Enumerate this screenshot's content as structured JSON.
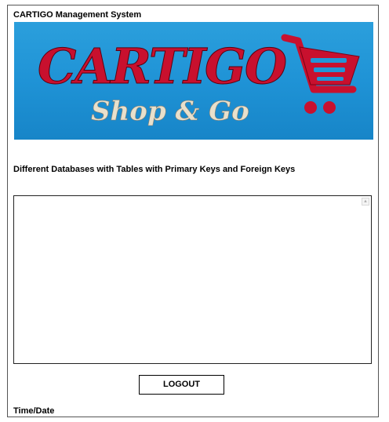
{
  "window": {
    "title": "CARTIGO Management System"
  },
  "banner": {
    "brand": "CARTIGO",
    "tagline": "Shop & Go",
    "icon": "shopping-cart-icon",
    "colors": {
      "background": "#2196d8",
      "brand_text": "#c8102e",
      "tagline_text": "#e8e0cc",
      "cart": "#c8102e"
    }
  },
  "main": {
    "subtitle": "Different Databases with Tables with Primary Keys and Foreign Keys",
    "output_text": ""
  },
  "footer": {
    "logout_label": "LOGOUT",
    "timedate_label": "Time/Date"
  }
}
